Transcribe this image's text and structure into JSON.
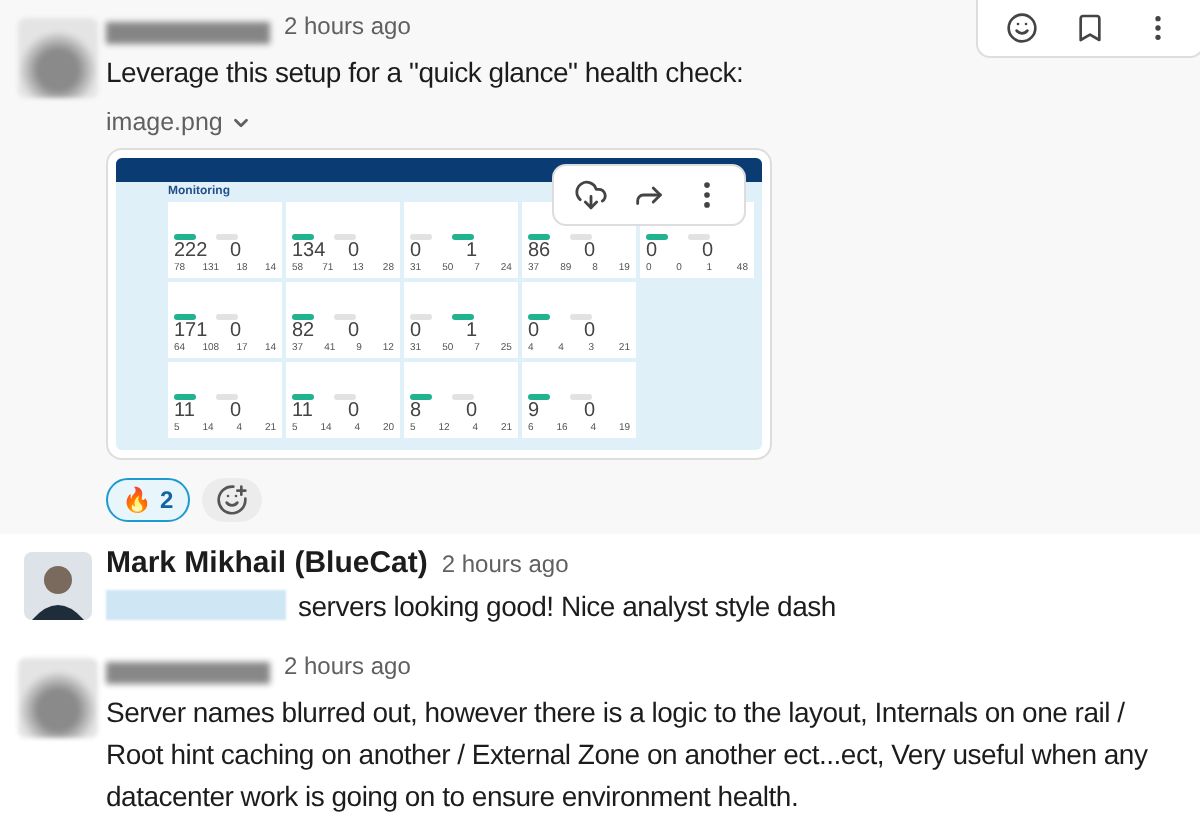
{
  "messages": [
    {
      "avatar": {
        "kind": "blurred"
      },
      "time": "2 hours ago",
      "hovered": true,
      "parts": [
        {
          "kind": "text",
          "text": "Leverage this setup for a \"quick glance\" health check:"
        }
      ],
      "attachment": {
        "filename": "image.png",
        "dashboard": {
          "title": "Monitoring",
          "rows": [
            [
              {
                "a": "222",
                "b": "0",
                "a_ok": true,
                "b_ok": false,
                "small": [
                  "78",
                  "131",
                  "18",
                  "14"
                ]
              },
              {
                "a": "134",
                "b": "0",
                "a_ok": true,
                "b_ok": false,
                "small": [
                  "58",
                  "71",
                  "13",
                  "28"
                ]
              },
              {
                "a": "0",
                "b": "1",
                "a_ok": false,
                "b_ok": true,
                "small": [
                  "31",
                  "50",
                  "7",
                  "24"
                ]
              },
              {
                "a": "86",
                "b": "0",
                "a_ok": true,
                "b_ok": false,
                "small": [
                  "37",
                  "89",
                  "8",
                  "19"
                ]
              },
              {
                "a": "0",
                "b": "0",
                "a_ok": true,
                "b_ok": false,
                "small": [
                  "0",
                  "0",
                  "1",
                  "48"
                ]
              }
            ],
            [
              {
                "a": "171",
                "b": "0",
                "a_ok": true,
                "b_ok": false,
                "small": [
                  "64",
                  "108",
                  "17",
                  "14"
                ]
              },
              {
                "a": "82",
                "b": "0",
                "a_ok": true,
                "b_ok": false,
                "small": [
                  "37",
                  "41",
                  "9",
                  "12"
                ]
              },
              {
                "a": "0",
                "b": "1",
                "a_ok": false,
                "b_ok": true,
                "small": [
                  "31",
                  "50",
                  "7",
                  "25"
                ]
              },
              {
                "a": "0",
                "b": "0",
                "a_ok": true,
                "b_ok": false,
                "small": [
                  "4",
                  "4",
                  "3",
                  "21"
                ]
              }
            ],
            [
              {
                "a": "11",
                "b": "0",
                "a_ok": true,
                "b_ok": false,
                "small": [
                  "5",
                  "14",
                  "4",
                  "21"
                ]
              },
              {
                "a": "11",
                "b": "0",
                "a_ok": true,
                "b_ok": false,
                "small": [
                  "5",
                  "14",
                  "4",
                  "20"
                ]
              },
              {
                "a": "8",
                "b": "0",
                "a_ok": true,
                "b_ok": false,
                "small": [
                  "5",
                  "12",
                  "4",
                  "21"
                ]
              },
              {
                "a": "9",
                "b": "0",
                "a_ok": true,
                "b_ok": false,
                "small": [
                  "6",
                  "16",
                  "4",
                  "19"
                ]
              }
            ]
          ]
        }
      },
      "reactions": [
        {
          "emoji": "🔥",
          "count": "2",
          "selected": true
        }
      ]
    },
    {
      "avatar": {
        "kind": "photo"
      },
      "author": "Mark Mikhail (BlueCat)",
      "time": "2 hours ago",
      "hovered": false,
      "parts": [
        {
          "kind": "blurred_mention"
        },
        {
          "kind": "text",
          "text": "servers looking good! Nice analyst style dash"
        }
      ]
    },
    {
      "avatar": {
        "kind": "blurred"
      },
      "time": "2 hours ago",
      "hovered": false,
      "parts": [
        {
          "kind": "text",
          "text": "Server names blurred out,  however there is a logic to the layout, Internals on one rail / Root hint caching on another / External Zone on another ect...ect,  Very useful when any datacenter work is going on to ensure environment health."
        }
      ]
    }
  ]
}
